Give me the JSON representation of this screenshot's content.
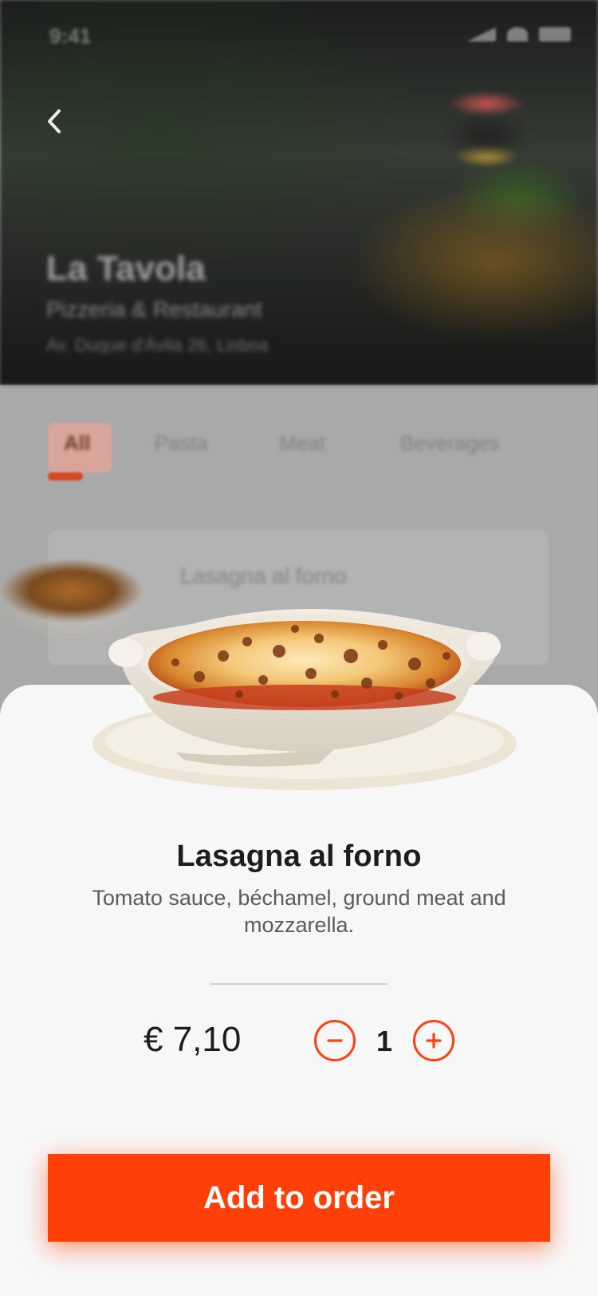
{
  "status_bar": {
    "time": "9:41"
  },
  "restaurant": {
    "name": "La Tavola",
    "type": "Pizzeria & Restaurant",
    "address": "Av. Duque d'Ávila 26, Lisboa"
  },
  "categories": {
    "items": [
      "All",
      "Pasta",
      "Meat",
      "Beverages"
    ],
    "active": "All"
  },
  "list_preview": {
    "title": "Lasagna al forno"
  },
  "dish": {
    "title": "Lasagna al forno",
    "description": "Tomato sauce, béchamel, ground meat and mozzarella.",
    "price": "€ 7,10",
    "quantity": "1"
  },
  "actions": {
    "add_label": "Add to order"
  },
  "colors": {
    "accent": "#FF4008",
    "sheet": "#F7F7F7",
    "text": "#1D1D1D"
  },
  "icons": {
    "back": "chevron-left-icon",
    "minus": "minus-circle-icon",
    "plus": "plus-circle-icon"
  }
}
